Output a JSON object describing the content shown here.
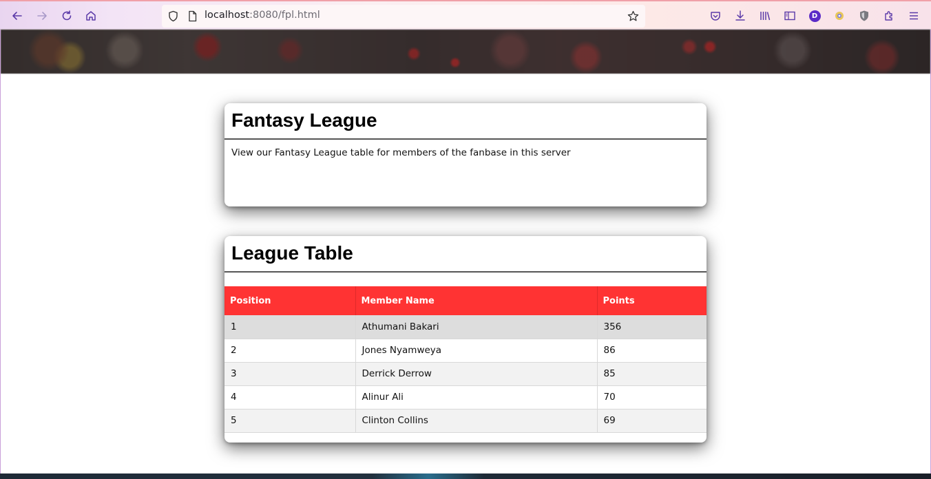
{
  "browser": {
    "url_host": "localhost",
    "url_rest": ":8080/fpl.html",
    "profile_initial": "D"
  },
  "intro_card": {
    "title": "Fantasy League",
    "text": "View our Fantasy League table for members of the fanbase in this server"
  },
  "league_card": {
    "title": "League Table",
    "columns": [
      "Position",
      "Member Name",
      "Points"
    ],
    "rows": [
      {
        "position": "1",
        "name": "Athumani Bakari",
        "points": "356"
      },
      {
        "position": "2",
        "name": "Jones Nyamweya",
        "points": "86"
      },
      {
        "position": "3",
        "name": "Derrick Derrow",
        "points": "85"
      },
      {
        "position": "4",
        "name": "Alinur Ali",
        "points": "70"
      },
      {
        "position": "5",
        "name": "Clinton Collins",
        "points": "69"
      }
    ]
  },
  "colors": {
    "table_header": "#ff3333",
    "accent_purple": "#5b2bc7"
  },
  "icons": [
    "back-icon",
    "forward-icon",
    "reload-icon",
    "home-icon",
    "shield-icon",
    "page-icon",
    "star-icon",
    "pocket-icon",
    "download-icon",
    "library-icon",
    "sidebar-icon",
    "profile-icon",
    "extension-icon",
    "ublock-icon",
    "extensions-icon",
    "menu-icon"
  ]
}
